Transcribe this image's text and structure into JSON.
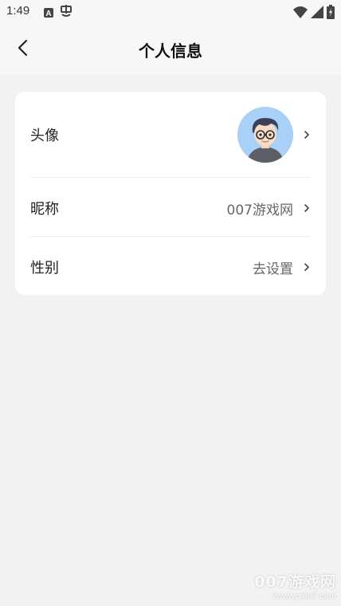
{
  "status_bar": {
    "time": "1:49",
    "icons": [
      "a-badge-icon",
      "notification-app-icon",
      "wifi-icon",
      "signal-icon",
      "battery-icon"
    ]
  },
  "header": {
    "title": "个人信息",
    "back_icon": "chevron-left-icon"
  },
  "profile": {
    "rows": [
      {
        "label": "头像",
        "value": "",
        "type": "avatar"
      },
      {
        "label": "昵称",
        "value": "007游戏网"
      },
      {
        "label": "性别",
        "value": "去设置"
      }
    ]
  },
  "watermark": {
    "main": "007游戏网",
    "sub": "www.yx007.com"
  },
  "colors": {
    "background": "#f2f2f2",
    "card": "#ffffff",
    "avatar_bg": "#a9d0f7"
  }
}
